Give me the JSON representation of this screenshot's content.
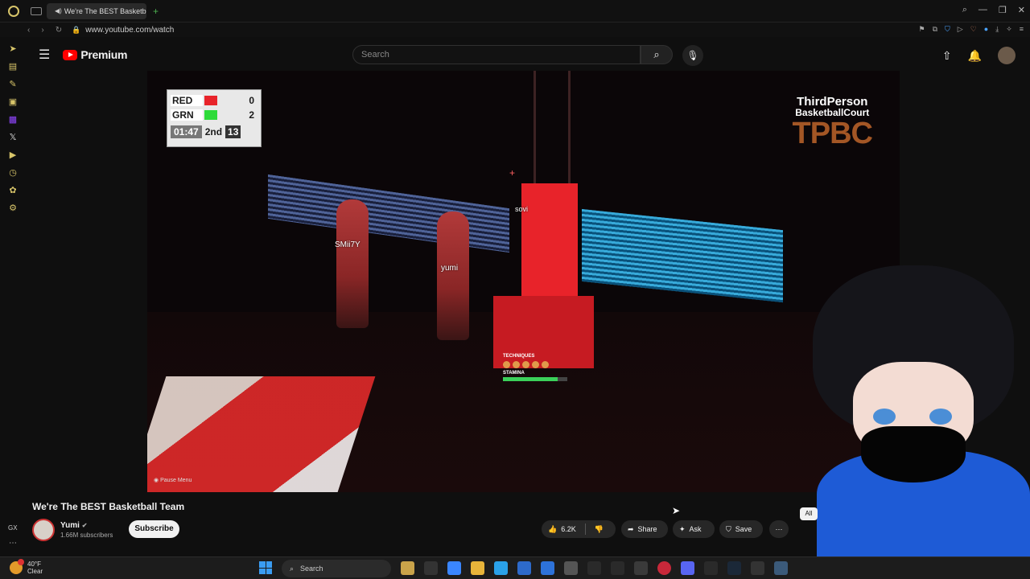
{
  "browser": {
    "tab_title": "We're The BEST Basketball Team",
    "url": "www.youtube.com/watch",
    "new_tab": "+"
  },
  "header": {
    "logo_text": "Premium",
    "search_placeholder": "Search"
  },
  "video": {
    "scoreboard": {
      "team1": "RED",
      "score1": "0",
      "team2": "GRN",
      "score2": "2",
      "clock": "01:47",
      "period": "2nd",
      "shot_clock": "13"
    },
    "brand": {
      "line1": "ThirdPerson",
      "line2": "BasketballCourt",
      "line3": "TPBC"
    },
    "players": [
      "SMii7Y",
      "yumi",
      "sovi"
    ],
    "hud_techniques": "TECHNIQUES",
    "hud_stamina": "STAMINA",
    "stamina_level": 0.85,
    "pause_menu": "Pause Menu"
  },
  "meta": {
    "title": "We're The BEST Basketball Team",
    "channel": "Yumi",
    "subscribers": "1.66M subscribers",
    "subscribe": "Subscribe",
    "likes": "6.2K",
    "share": "Share",
    "ask": "Ask",
    "save": "Save",
    "all_chip": "All"
  },
  "taskbar": {
    "temp": "40°F",
    "condition": "Clear",
    "search": "Search"
  },
  "sidebar": {
    "gx": "GX"
  },
  "colors": {
    "youtube_red": "#ff0000",
    "opera_gold": "#d8c56a",
    "hoodie_blue": "#1e5bd6"
  }
}
